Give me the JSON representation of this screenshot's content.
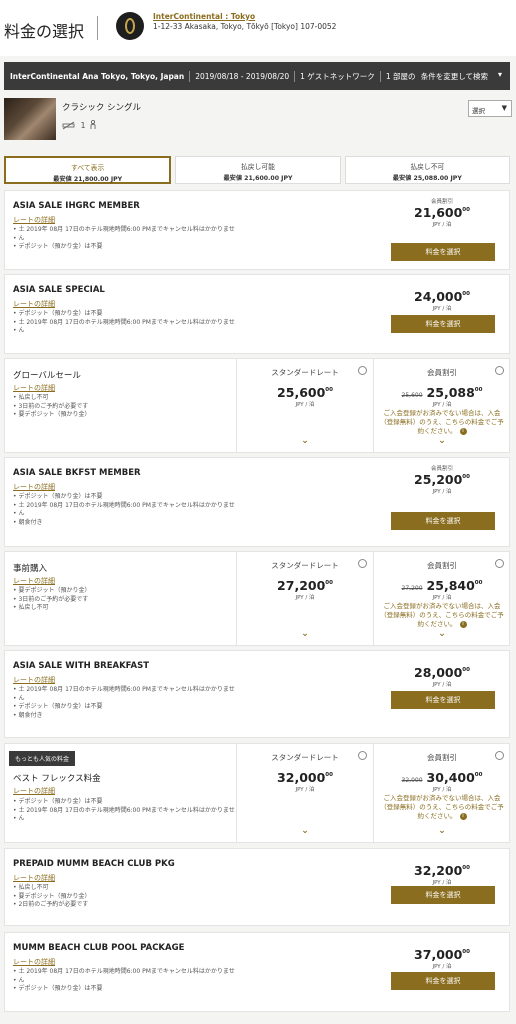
{
  "header": {
    "title": "料金の選択",
    "hotel_name": "InterContinental : Tokyo",
    "hotel_address": "1-12-33 Akasaka, Tokyo, Tōkyō [Tokyo] 107-0052"
  },
  "search": {
    "hotel": "InterContinental Ana Tokyo, Tokyo, Japan",
    "dates": "2019/08/18 - 2019/08/20",
    "guests": "1 ゲストネットワーク",
    "rooms": "1 部屋の",
    "change": "条件を変更して検索",
    "chevron": "▾"
  },
  "room": {
    "name": "クラシック シングル",
    "bed_count": "1",
    "select_label": "選択",
    "select_arrow": "▼",
    "icons": [
      "no-smoking-icon",
      "person-icon"
    ]
  },
  "tabs": [
    {
      "label": "すべて表示",
      "price": "最安値 21,800.00 JPY"
    },
    {
      "label": "払戻し可能",
      "price": "最安値 21,600.00 JPY"
    },
    {
      "label": "払戻し不可",
      "price": "最安値 25,088.00 JPY"
    }
  ],
  "rates": [
    {
      "name": "ASIA SALE IHGRC MEMBER",
      "link": "レートの詳細",
      "bullets": [
        "土 2019年 08月 17日のホテル現地時間6:00 PMまでキャンセル料はかかりませ",
        "ん",
        "デポジット（預かり金）は不要"
      ],
      "member": "会員割引",
      "price": "21,600",
      "cents": "00",
      "unit": "JPY / 泊",
      "button": "料金を選択"
    },
    {
      "name": "ASIA SALE SPECIAL",
      "link": "レートの詳細",
      "bullets": [
        "デポジット（預かり金）は不要",
        "土 2019年 08月 17日のホテル現地時間6:00 PMまでキャンセル料はかかりませ",
        "ん"
      ],
      "member": "",
      "price": "24,000",
      "cents": "00",
      "unit": "JPY / 泊",
      "button": "料金を選択"
    },
    {
      "name": "グローバルセール",
      "link": "レートの詳細",
      "bullets": [
        "払戻し不可",
        "3日前のご予約が必要です",
        "要デポジット（預かり金）"
      ],
      "std_label": "スタンダードレート",
      "std_price": "25,600",
      "std_cents": "00",
      "std_unit": "JPY / 泊",
      "mem_label": "会員割引",
      "mem_old": "25,600",
      "mem_price": "25,088",
      "mem_cents": "00",
      "mem_unit": "JPY / 泊",
      "note": "ご入会登録がお済みでない場合は、入会（登録無料）のうえ、こちらの料金でご予約ください。",
      "info": "i",
      "chev": "⌄"
    },
    {
      "name": "ASIA SALE BKFST MEMBER",
      "link": "レートの詳細",
      "bullets": [
        "デポジット（預かり金）は不要",
        "土 2019年 08月 17日のホテル現地時間6:00 PMまでキャンセル料はかかりませ",
        "ん",
        "朝食付き"
      ],
      "member": "会員割引",
      "price": "25,200",
      "cents": "00",
      "unit": "JPY / 泊",
      "button": "料金を選択"
    },
    {
      "name": "事前購入",
      "link": "レートの詳細",
      "bullets": [
        "要デポジット（預かり金）",
        "3日前のご予約が必要です",
        "払戻し不可"
      ],
      "std_label": "スタンダードレート",
      "std_price": "27,200",
      "std_cents": "00",
      "std_unit": "JPY / 泊",
      "mem_label": "会員割引",
      "mem_old": "27,200",
      "mem_price": "25,840",
      "mem_cents": "00",
      "mem_unit": "JPY / 泊",
      "note": "ご入会登録がお済みでない場合は、入会（登録無料）のうえ、こちらの料金でご予約ください。",
      "info": "i",
      "chev": "⌄"
    },
    {
      "name": "ASIA SALE WITH BREAKFAST",
      "link": "レートの詳細",
      "bullets": [
        "土 2019年 08月 17日のホテル現地時間6:00 PMまでキャンセル料はかかりませ",
        "ん",
        "デポジット（預かり金）は不要",
        "朝食付き"
      ],
      "member": "",
      "price": "28,000",
      "cents": "00",
      "unit": "JPY / 泊",
      "button": "料金を選択"
    },
    {
      "badge": "もっとも人気の料金",
      "name": "ベスト フレックス料金",
      "link": "レートの詳細",
      "bullets": [
        "デポジット（預かり金）は不要",
        "土 2019年 08月 17日のホテル現地時間6:00 PMまでキャンセル料はかかりませ",
        "ん"
      ],
      "std_label": "スタンダードレート",
      "std_price": "32,000",
      "std_cents": "00",
      "std_unit": "JPY / 泊",
      "mem_label": "会員割引",
      "mem_old": "32,000",
      "mem_price": "30,400",
      "mem_cents": "00",
      "mem_unit": "JPY / 泊",
      "note": "ご入会登録がお済みでない場合は、入会（登録無料）のうえ、こちらの料金でご予約ください。",
      "info": "i",
      "chev": "⌄"
    },
    {
      "name": "PREPAID MUMM BEACH CLUB PKG",
      "link": "レートの詳細",
      "bullets": [
        "払戻し不可",
        "要デポジット（預かり金）",
        "2日前のご予約が必要です"
      ],
      "member": "",
      "price": "32,200",
      "cents": "00",
      "unit": "JPY / 泊",
      "button": "料金を選択"
    },
    {
      "name": "MUMM BEACH CLUB POOL PACKAGE",
      "link": "レートの詳細",
      "bullets": [
        "土 2019年 08月 17日のホテル現地時間6:00 PMまでキャンセル料はかかりませ",
        "ん",
        "デポジット（預かり金）は不要"
      ],
      "member": "",
      "price": "37,000",
      "cents": "00",
      "unit": "JPY / 泊",
      "button": "料金を選択"
    }
  ],
  "colors": {
    "accent": "#8a6d1e",
    "bar": "#3a3a3a"
  }
}
